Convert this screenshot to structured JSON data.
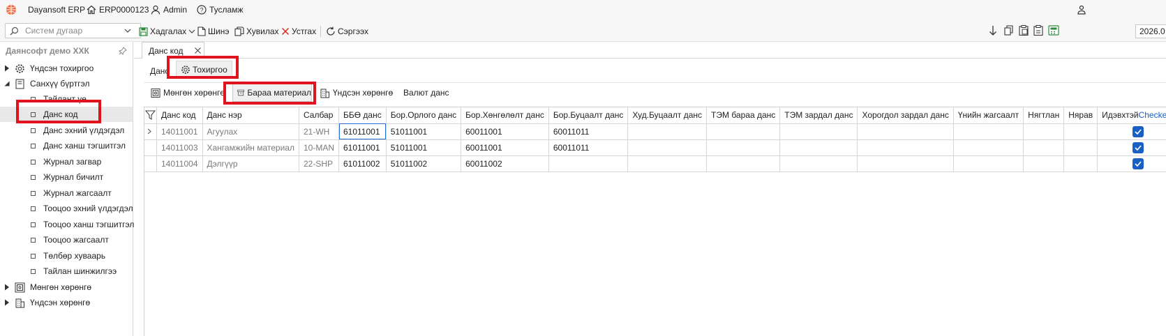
{
  "titlebar": {
    "app_name": "Dayansoft ERP",
    "document_no": "ERP0000123",
    "user": "Admin",
    "help": "Тусламж"
  },
  "toolbar": {
    "search_placeholder": "Систем дугаар",
    "save": "Хадгалах",
    "new": "Шинэ",
    "copy": "Хувилах",
    "delete": "Устгах",
    "refresh": "Сэргээх",
    "year": "2026.0"
  },
  "sidebar": {
    "company": "Даянсофт демо ХХК",
    "items": [
      {
        "label": "Үндсэн тохиргоо",
        "icon": "gear-icon"
      },
      {
        "label": "Санхүү бүртгэл",
        "icon": "ledger-icon"
      },
      {
        "label": "Тайлант үе"
      },
      {
        "label": "Данс код"
      },
      {
        "label": "Данс эхний үлдэгдэл"
      },
      {
        "label": "Данс ханш тэгшитгэл"
      },
      {
        "label": "Журнал загвар"
      },
      {
        "label": "Журнал бичилт"
      },
      {
        "label": "Журнал жагсаалт"
      },
      {
        "label": "Тооцоо эхний үлдэгдэл"
      },
      {
        "label": "Тооцоо ханш тэгшитгэл"
      },
      {
        "label": "Тооцоо жагсаалт"
      },
      {
        "label": "Төлбөр хуваарь"
      },
      {
        "label": "Тайлан шинжилгээ"
      },
      {
        "label": "Мөнгөн хөрөнгө",
        "icon": "cash-icon"
      },
      {
        "label": "Үндсэн хөрөнгө",
        "icon": "building-icon"
      }
    ]
  },
  "main": {
    "doc_tab": "Данс код",
    "subtabs": {
      "account": "Данс",
      "settings": "Тохиргоо"
    },
    "category_tabs": {
      "cash": "Мөнгөн хөрөнгө",
      "inventory": "Бараа материал",
      "fixed_assets": "Үндсэн хөрөнгө",
      "currency": "Валют данс"
    }
  },
  "grid": {
    "columns": [
      "Данс код",
      "Данс нэр",
      "Салбар",
      "ББӨ данс",
      "Бор.Орлого данс",
      "Бор.Хөнгөлөлт данс",
      "Бор.Буцаалт данс",
      "Худ.Буцаалт данс",
      "ТЭМ бараа данс",
      "ТЭМ зардал данс",
      "Хорогдол зардал данс",
      "Үнийн жагсаалт",
      "Нягтлан",
      "Нярав",
      "Идэвхтэй"
    ],
    "checked_label": "Checked",
    "rows": [
      {
        "code": "14011001",
        "name": "Агуулах",
        "branch": "21-WH",
        "bbo": "61011001",
        "income": "51011001",
        "discount": "60011001",
        "return": "60011011",
        "active": true
      },
      {
        "code": "14011003",
        "name": "Хангамжийн материал",
        "branch": "10-MAN",
        "bbo": "61011001",
        "income": "51011001",
        "discount": "60011001",
        "return": "60011011",
        "active": true
      },
      {
        "code": "14011004",
        "name": "Дэлгүүр",
        "branch": "22-SHP",
        "bbo": "61011002",
        "income": "51011002",
        "discount": "60011002",
        "return": "",
        "active": true
      }
    ]
  },
  "colors": {
    "accent": "#1a5fc4",
    "highlight": "#e0141e",
    "save_green": "#2e8b3a",
    "delete_red": "#d9281e"
  }
}
